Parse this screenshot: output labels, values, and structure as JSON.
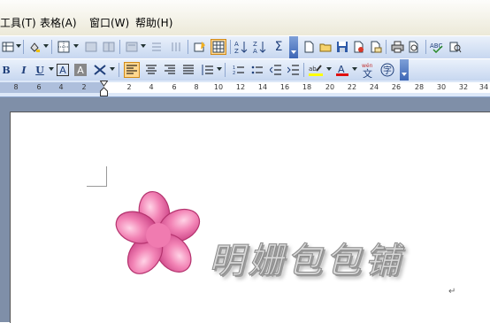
{
  "menubar": {
    "items": [
      {
        "label": "工具(T)"
      },
      {
        "label": "表格(A)"
      },
      {
        "label": "窗口(W)"
      },
      {
        "label": "帮助(H)"
      }
    ]
  },
  "toolbar": {
    "icons": [
      "insert-table-icon",
      "shading-icon",
      "borders-icon",
      "text-box-icon",
      "columns-icon",
      "frame-icon",
      "split-cells-icon",
      "autoformat-icon",
      "table-active-icon",
      "sort-ascending-icon",
      "sort-descending-icon",
      "sum-icon",
      "new-doc-icon",
      "open-icon",
      "save-icon",
      "permission-icon",
      "email-icon",
      "print-icon",
      "print-preview-icon",
      "spelling-icon",
      "research-icon"
    ]
  },
  "formatting": {
    "bold": "B",
    "italic": "I",
    "underline": "U",
    "char_border": "A",
    "char_shade": "A",
    "phonetic": "wén",
    "enclose": "字"
  },
  "ruler": {
    "numbers": [
      "8",
      "6",
      "4",
      "2",
      "2",
      "4",
      "6",
      "8",
      "10",
      "12",
      "14",
      "16",
      "18",
      "20",
      "22",
      "24",
      "26",
      "28",
      "30",
      "32",
      "34"
    ]
  },
  "document": {
    "brand_text": "明姗包包铺",
    "paragraph_mark": "↵"
  },
  "colors": {
    "petal": "#ec6fa5",
    "toolbar_top": "#eaf1fb",
    "toolbar_bottom": "#c7d7f0",
    "active_button": "#ffd78f"
  }
}
